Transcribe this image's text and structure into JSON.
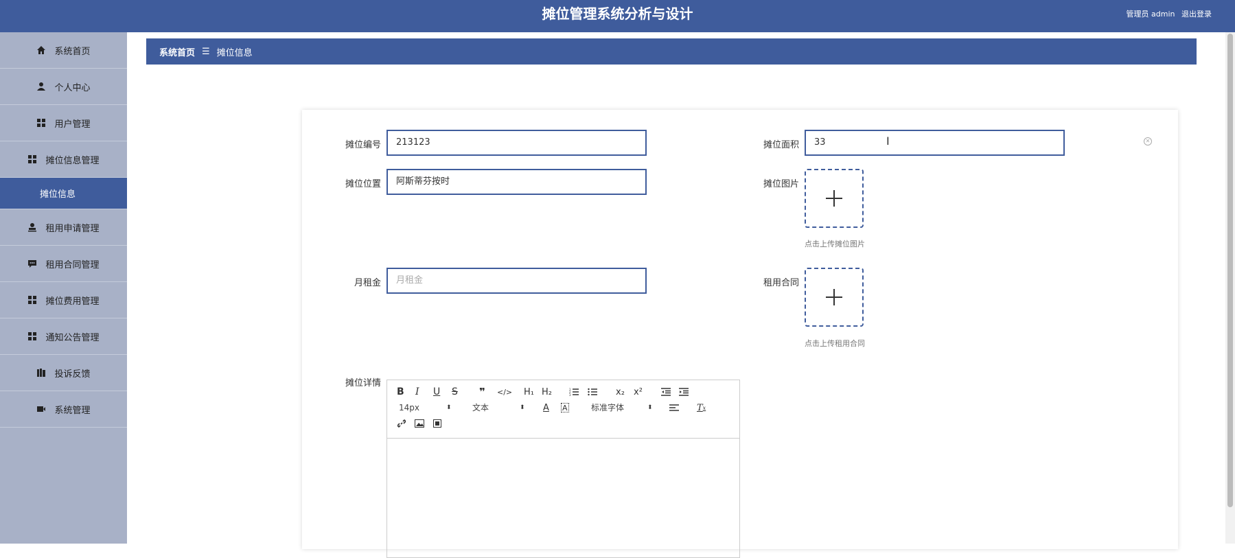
{
  "header": {
    "title": "摊位管理系统分析与设计",
    "user_label": "管理员 admin",
    "logout": "退出登录"
  },
  "sidebar": {
    "items": [
      {
        "label": "系统首页",
        "icon": "home-icon"
      },
      {
        "label": "个人中心",
        "icon": "person-icon"
      },
      {
        "label": "用户管理",
        "icon": "grid-icon"
      },
      {
        "label": "摊位信息管理",
        "icon": "grid-icon"
      },
      {
        "label": "摊位信息",
        "icon": ""
      },
      {
        "label": "租用申请管理",
        "icon": "stamp-icon"
      },
      {
        "label": "租用合同管理",
        "icon": "chat-icon"
      },
      {
        "label": "摊位费用管理",
        "icon": "grid-icon"
      },
      {
        "label": "通知公告管理",
        "icon": "grid-icon"
      },
      {
        "label": "投诉反馈",
        "icon": "book-icon"
      },
      {
        "label": "系统管理",
        "icon": "video-icon"
      }
    ]
  },
  "breadcrumb": {
    "home": "系统首页",
    "separator": "☰",
    "current": "摊位信息"
  },
  "form": {
    "code_label": "摊位编号",
    "code_value": "213123",
    "area_label": "摊位面积",
    "area_value": "33",
    "location_label": "摊位位置",
    "location_value": "阿斯蒂芬按时",
    "image_label": "摊位图片",
    "image_hint": "点击上传摊位图片",
    "rent_label": "月租金",
    "rent_placeholder": "月租金",
    "contract_label": "租用合同",
    "contract_hint": "点击上传租用合同",
    "detail_label": "摊位详情"
  },
  "editor": {
    "font_size": "14px",
    "text_style": "文本",
    "font_family": "标准字体"
  }
}
